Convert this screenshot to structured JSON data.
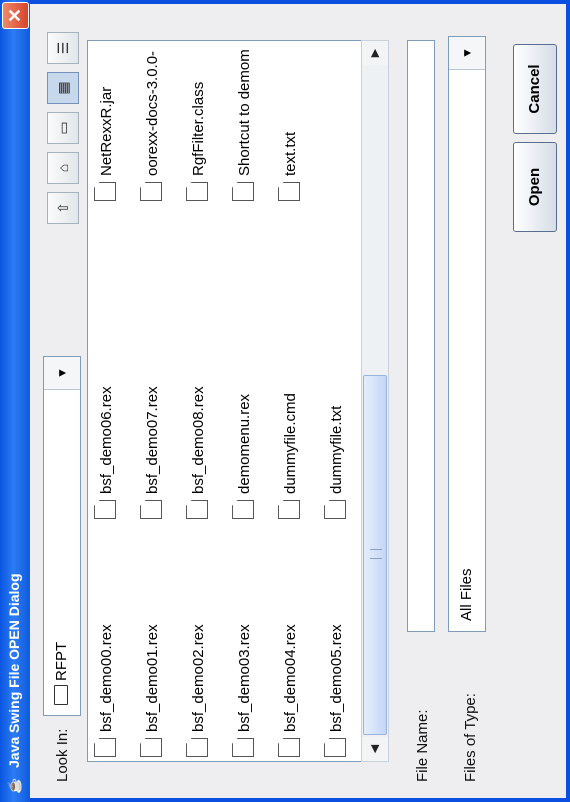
{
  "window": {
    "title": "Java Swing File OPEN Dialog",
    "close_glyph": "✕",
    "app_icon": "java-cup-icon"
  },
  "look_in": {
    "label": "Look In:",
    "value": "RFPT"
  },
  "toolbar": {
    "icons": [
      "up-folder-icon",
      "home-icon",
      "new-folder-icon",
      "list-view-icon",
      "details-view-icon"
    ],
    "active": "list-view-icon"
  },
  "files": {
    "col1": [
      "bsf_demo00.rex",
      "bsf_demo01.rex",
      "bsf_demo02.rex",
      "bsf_demo03.rex",
      "bsf_demo04.rex",
      "bsf_demo05.rex"
    ],
    "col2": [
      "bsf_demo06.rex",
      "bsf_demo07.rex",
      "bsf_demo08.rex",
      "demomenu.rex",
      "dummyfile.cmd",
      "dummyfile.txt"
    ],
    "col3": [
      "NetRexxR.jar",
      "oorexx-docs-3.0.0-",
      "RgfFilter.class",
      "Shortcut to demom",
      "text.txt"
    ]
  },
  "file_name": {
    "label": "File Name:",
    "value": ""
  },
  "files_of_type": {
    "label": "Files of Type:",
    "value": "All Files"
  },
  "buttons": {
    "open": "Open",
    "cancel": "Cancel"
  },
  "colors": {
    "titlebar": "#1a63e8",
    "accent": "#0a4fe0"
  }
}
